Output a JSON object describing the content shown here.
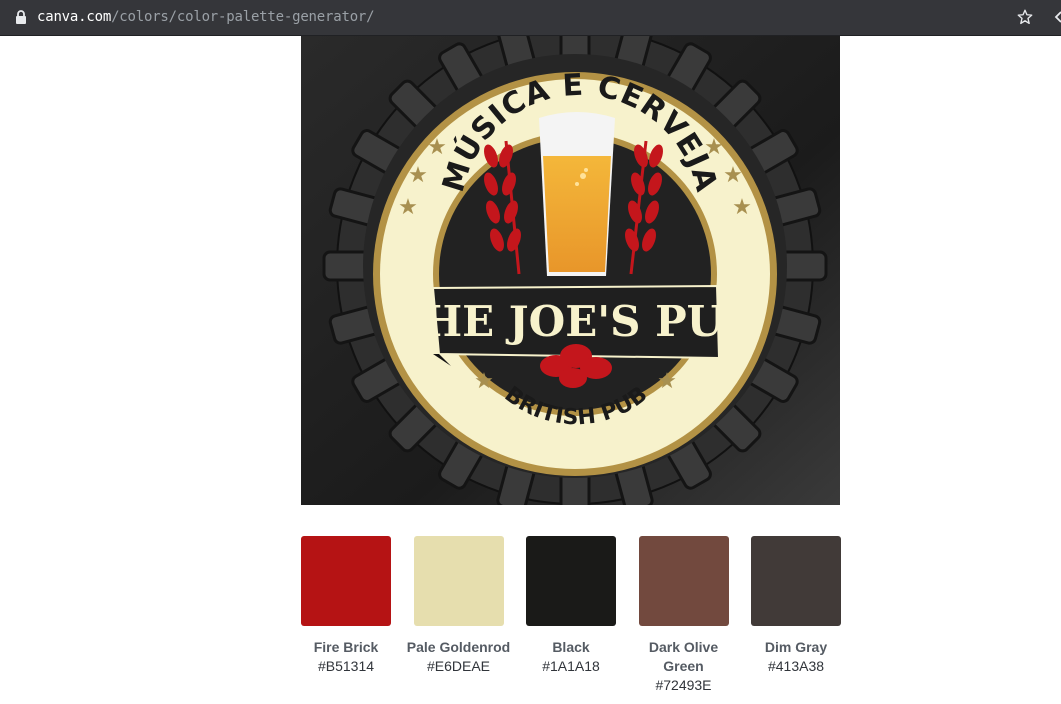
{
  "browser": {
    "url_host": "canva.com",
    "url_path": "/colors/color-palette-generator/"
  },
  "logo": {
    "top_text": "MÚSICA E CERVEJA",
    "name": "THE JOE'S PUB",
    "bottom_text": "BRITISH PUB"
  },
  "palette": [
    {
      "name": "Fire Brick",
      "hex": "#B51314",
      "color": "#B51314"
    },
    {
      "name": "Pale Goldenrod",
      "hex": "#E6DEAE",
      "color": "#E6DEAE"
    },
    {
      "name": "Black",
      "hex": "#1A1A18",
      "color": "#1A1A18"
    },
    {
      "name": "Dark Olive Green",
      "hex": "#72493E",
      "color": "#72493E"
    },
    {
      "name": "Dim Gray",
      "hex": "#413A38",
      "color": "#413A38"
    }
  ]
}
